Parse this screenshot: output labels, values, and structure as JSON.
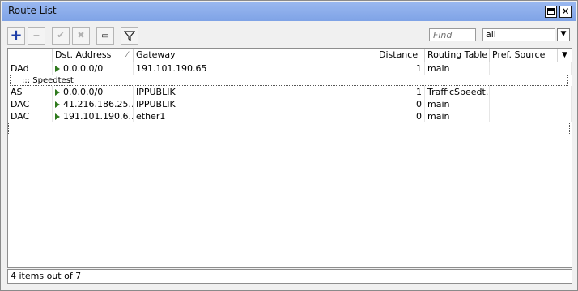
{
  "window": {
    "title": "Route List"
  },
  "toolbar": {
    "find_placeholder": "Find",
    "filter_value": "all"
  },
  "columns": [
    "Dst. Address",
    "Gateway",
    "Distance",
    "Routing Table",
    "Pref. Source"
  ],
  "rows": [
    {
      "flags": "DAd",
      "dst": "0.0.0.0/0",
      "gateway": "191.101.190.65",
      "distance": "1",
      "table": "main",
      "pref": ""
    },
    {
      "comment": "::: Speedtest"
    },
    {
      "flags": "AS",
      "dst": "0.0.0.0/0",
      "gateway": "IPPUBLIK",
      "distance": "1",
      "table": "TrafficSpeedt...",
      "pref": ""
    },
    {
      "flags": "DAC",
      "dst": "41.216.186.25...",
      "gateway": "IPPUBLIK",
      "distance": "0",
      "table": "main",
      "pref": ""
    },
    {
      "flags": "DAC",
      "dst": "191.101.190.6...",
      "gateway": "ether1",
      "distance": "0",
      "table": "main",
      "pref": ""
    }
  ],
  "status": {
    "text": "4 items out of 7"
  }
}
